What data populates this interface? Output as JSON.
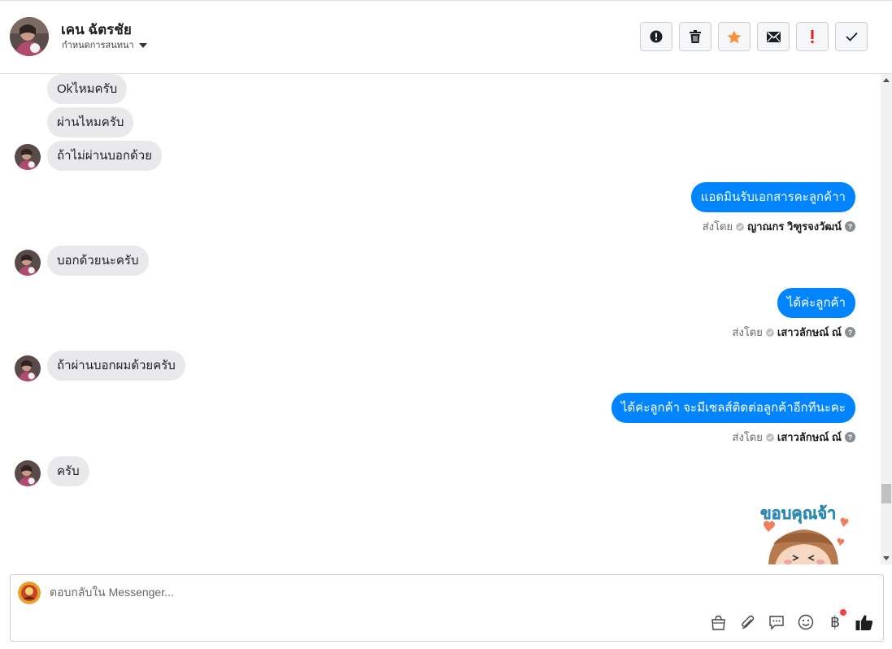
{
  "header": {
    "contact_name": "เคน ฉัตรชัย",
    "assign_label": "กำหนดการสนทนา",
    "actions": [
      {
        "name": "spam-button",
        "icon": "alert-circle-icon"
      },
      {
        "name": "delete-button",
        "icon": "trash-icon"
      },
      {
        "name": "star-button",
        "icon": "star-icon"
      },
      {
        "name": "mark-unread-button",
        "icon": "envelope-icon"
      },
      {
        "name": "important-button",
        "icon": "exclamation-icon"
      },
      {
        "name": "mark-done-button",
        "icon": "checkmark-icon"
      }
    ]
  },
  "messages": {
    "in_1": "Okไหมครับ",
    "in_2": "ผ่านไหมครับ",
    "in_3": "ถ้าไม่ผ่านบอกด้วย",
    "out_1": "แอดมินรับเอกสารคะลูกค้าา",
    "sent_by_label": "ส่งโดย",
    "out_1_sender": "ญาณกร วิฑูรจงวัฒน์",
    "in_4": "บอกด้วยนะครับ",
    "out_2": "ได้ค่ะลูกค้า",
    "out_2_sender": "เสาวลักษณ์ ณ์",
    "in_5": "ถ้าผ่านบอกผมด้วยครับ",
    "out_3": "ได้ค่ะลูกค้า จะมีเซลส์ติดต่อลูกค้าอีกทีนะคะ",
    "out_3_sender": "เสาวลักษณ์ ณ์",
    "in_6": "ครับ",
    "sticker_text": "ขอบคุณจ้า",
    "help_glyph": "?"
  },
  "composer": {
    "placeholder": "ตอบกลับใน Messenger...",
    "tools": [
      "shop-bag-icon",
      "paperclip-icon",
      "saved-reply-icon",
      "emoji-icon",
      "baht-payment-icon",
      "like-icon"
    ],
    "baht_symbol": "฿"
  },
  "colors": {
    "outgoing_bubble": "#0084ff",
    "incoming_bubble": "#e9e9eb",
    "star": "#f7923a",
    "important": "#e02020",
    "notification_dot": "#fa3e3e"
  }
}
